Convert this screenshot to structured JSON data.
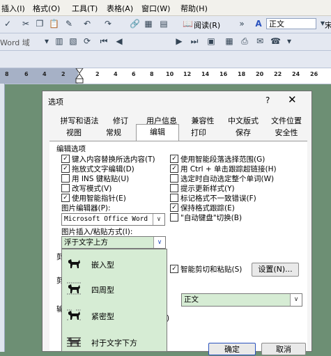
{
  "menubar": {
    "items": [
      "插入(I)",
      "格式(O)",
      "工具(T)",
      "表格(A)",
      "窗口(W)",
      "帮助(H)"
    ]
  },
  "toolbar1": {
    "read_label": "阅读(R)",
    "style_value": "正文",
    "font_value": "宋"
  },
  "toolbar2": {
    "word_label": "Word 域"
  },
  "ruler": {
    "numbers": [
      "8",
      "6",
      "4",
      "2",
      "2",
      "4",
      "6",
      "8",
      "10",
      "12",
      "14",
      "16",
      "18",
      "20",
      "22",
      "24",
      "26"
    ]
  },
  "dialog": {
    "title": "选项",
    "help": "?",
    "close": "✕",
    "tabs_row1": [
      "拼写和语法",
      "修订",
      "用户信息",
      "兼容性",
      "中文版式",
      "文件位置"
    ],
    "tabs_row2": [
      "视图",
      "常规",
      "编辑",
      "打印",
      "保存",
      "安全性"
    ],
    "section_title": "编辑选项",
    "left_options": [
      {
        "label": "键入内容替换所选内容(T)",
        "checked": true
      },
      {
        "label": "拖放式文字编辑(D)",
        "checked": true
      },
      {
        "label": "用 INS 键粘贴(U)",
        "checked": false
      },
      {
        "label": "改写模式(V)",
        "checked": false
      },
      {
        "label": "使用智能指针(E)",
        "checked": true
      }
    ],
    "right_options": [
      {
        "label": "使用智能段落选择范围(G)",
        "checked": true
      },
      {
        "label": "用 Ctrl + 单击跟踪超链接(H)",
        "checked": true
      },
      {
        "label": "选定时自动选定整个单词(W)",
        "checked": false
      },
      {
        "label": "提示更新样式(Y)",
        "checked": false
      },
      {
        "label": "标记格式不一致错误(F)",
        "checked": false
      },
      {
        "label": "保持格式跟踪(E)",
        "checked": true
      },
      {
        "label": "\"自动键盘\"切换(B)",
        "checked": false
      }
    ],
    "picture_editor_label": "图片编辑器(P):",
    "picture_editor_value": "Microsoft Office Word",
    "insert_paste_label": "图片插入/粘贴方式(I):",
    "insert_paste_value": "浮于文字上方",
    "hidden_label_1": "剪",
    "hidden_label_2": "剪",
    "hidden_label_3": "输",
    "smart_cut_label": "智能剪切和粘贴(S)",
    "smart_cut_checked": true,
    "settings_button": "设置(N)...",
    "style_combo_value": "正文",
    "partial_text": ")",
    "ok_button": "确定",
    "cancel_button": "取消"
  },
  "dropdown": {
    "items": [
      "嵌入型",
      "四周型",
      "紧密型",
      "衬于文字下方"
    ]
  }
}
